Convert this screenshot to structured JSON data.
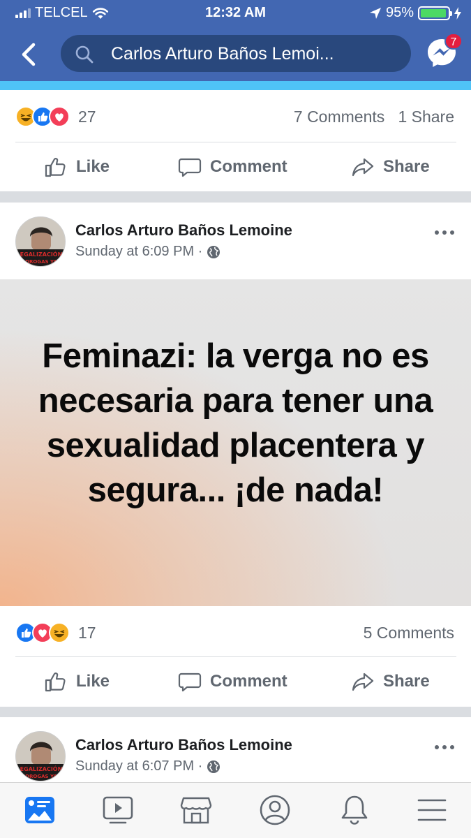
{
  "status_bar": {
    "carrier": "TELCEL",
    "time": "12:32 AM",
    "battery": "95%"
  },
  "header": {
    "search_text": "Carlos Arturo Baños Lemoi...",
    "messenger_badge": "7"
  },
  "post1_footer": {
    "reaction_icons": [
      "haha",
      "like",
      "love"
    ],
    "reaction_count": "27",
    "comments": "7 Comments",
    "shares": "1 Share",
    "actions": {
      "like": "Like",
      "comment": "Comment",
      "share": "Share"
    }
  },
  "post2": {
    "author": "Carlos Arturo Baños Lemoine",
    "timestamp": "Sunday at 6:09 PM ·",
    "privacy_icon": "globe-icon",
    "image_text": "Feminazi: la verga no es necesaria para tener una sexualidad placentera y segura... ¡de nada!",
    "avatar_text": "LEGALIZACIÓN DE TODAS LAS DROGAS YA",
    "reaction_icons": [
      "like",
      "love",
      "haha"
    ],
    "reaction_count": "17",
    "comments": "5 Comments",
    "actions": {
      "like": "Like",
      "comment": "Comment",
      "share": "Share"
    }
  },
  "post3": {
    "author": "Carlos Arturo Baños Lemoine",
    "timestamp": "Sunday at 6:07 PM ·",
    "privacy_icon": "globe-icon"
  },
  "tabbar": {
    "tabs": [
      "news-feed-icon",
      "watch-icon",
      "marketplace-icon",
      "profile-icon",
      "notifications-icon",
      "menu-icon"
    ],
    "active": "news-feed-icon"
  },
  "colors": {
    "brand": "#4267b2",
    "active_tab": "#1877f2",
    "like": "#1877f2",
    "love": "#f33e58",
    "haha": "#f7b125"
  }
}
